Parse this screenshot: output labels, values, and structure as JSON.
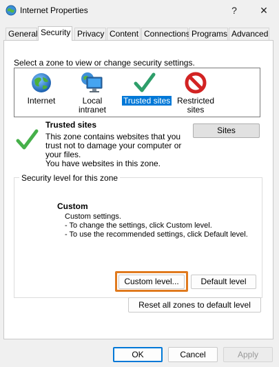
{
  "window": {
    "title": "Internet Properties",
    "help_glyph": "?",
    "close_glyph": "✕"
  },
  "tabs": [
    "General",
    "Security",
    "Privacy",
    "Content",
    "Connections",
    "Programs",
    "Advanced"
  ],
  "selected_tab": "Security",
  "zone_prompt": "Select a zone to view or change security settings.",
  "zones": [
    {
      "label": "Internet",
      "icon": "globe-icon"
    },
    {
      "label": "Local intranet",
      "icon": "intranet-monitor-icon"
    },
    {
      "label": "Trusted sites",
      "icon": "trusted-checkmark-icon",
      "selected": true
    },
    {
      "label": "Restricted sites",
      "icon": "restricted-prohibited-icon"
    }
  ],
  "zone_info": {
    "title": "Trusted sites",
    "desc_lines": [
      "This zone contains websites that you",
      "trust not to damage your computer or",
      "your files.",
      "You have websites in this zone."
    ],
    "sites_button": "Sites"
  },
  "security_level": {
    "legend": "Security level for this zone",
    "level_name": "Custom",
    "lines": [
      "Custom settings.",
      "- To change the settings, click Custom level.",
      "- To use the recommended settings, click Default level."
    ],
    "custom_button": "Custom level...",
    "default_button": "Default level"
  },
  "reset_button": "Reset all zones to default level",
  "footer": {
    "ok": "OK",
    "cancel": "Cancel",
    "apply": "Apply"
  },
  "colors": {
    "selection": "#0078d7",
    "highlight": "#e07a1e",
    "check": "#2e9e6a",
    "prohibit": "#d22323"
  }
}
